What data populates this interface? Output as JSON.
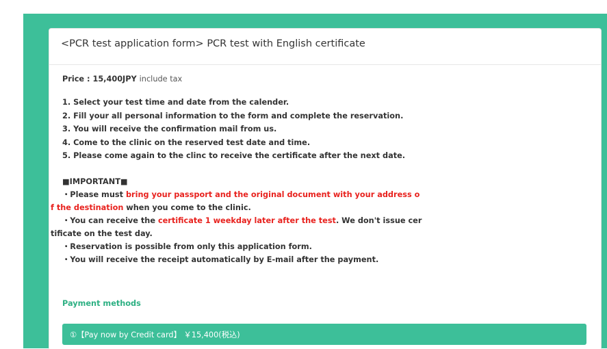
{
  "header": {
    "title": "<PCR test application form> PCR test with English certificate"
  },
  "price": {
    "label": "Price : 15,400JPY",
    "suffix": "include tax"
  },
  "steps": [
    "1. Select your test time and date from the calender.",
    "2. Fill your all personal information to the form and complete the reservation.",
    "3. You will receive the confirmation mail from us.",
    "4. Come to the clinic on the reserved test date and time.",
    "5. Please come again to the clinc to receive the certificate after the next date."
  ],
  "important": {
    "heading": "■IMPORTANT■",
    "item1_pre": "・Please must ",
    "item1_red1": "bring your passport and the original document with your address o",
    "item1_red2": "f the destination",
    "item1_post": " when you come to the clinic.",
    "item2_pre": "・You can receive the ",
    "item2_red": "certificate 1 weekday later after the test",
    "item2_post1": ". We don't issue cer",
    "item2_post2": "tificate on the test day.",
    "item3": "・Reservation is possible from only this application form.",
    "item4": "・You will receive the receipt automatically by E-mail after the payment."
  },
  "payment": {
    "label": "Payment methods",
    "option1": "①【Pay now by Credit card】 ￥15,400(税込)"
  },
  "colors": {
    "accent": "#3dbf99",
    "highlight_red": "#e8221e",
    "label_green": "#2db083"
  }
}
